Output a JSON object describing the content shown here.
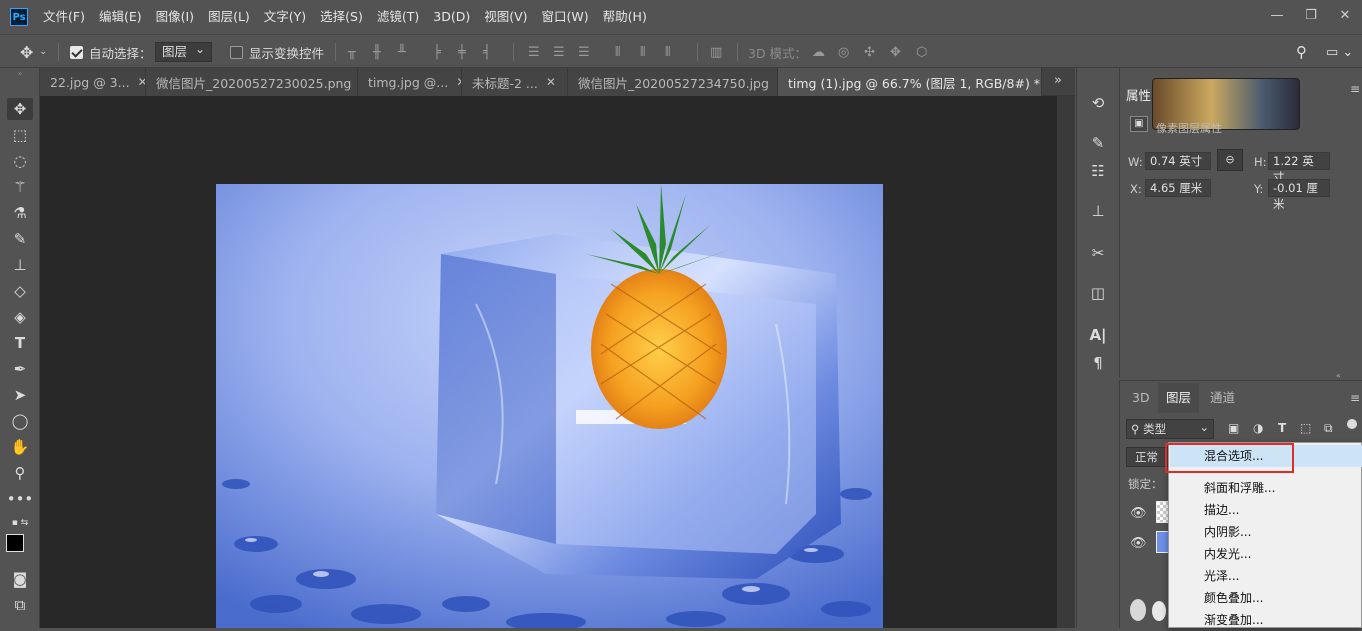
{
  "app": {
    "logo": "Ps"
  },
  "menu": [
    "文件(F)",
    "编辑(E)",
    "图像(I)",
    "图层(L)",
    "文字(Y)",
    "选择(S)",
    "滤镜(T)",
    "3D(D)",
    "视图(V)",
    "窗口(W)",
    "帮助(H)"
  ],
  "options": {
    "auto_select_label": "自动选择：",
    "auto_select_value": "图层",
    "show_transform_label": "显示变换控件",
    "mode_3d_label": "3D 模式："
  },
  "tabs": [
    {
      "label": "22.jpg @ 3...",
      "active": false
    },
    {
      "label": "微信图片_20200527230025.png",
      "active": false
    },
    {
      "label": "timg.jpg @...",
      "active": false
    },
    {
      "label": "未标题-2 ...",
      "active": false
    },
    {
      "label": "微信图片_20200527234750.jpg",
      "active": false
    },
    {
      "label": "timg (1).jpg @ 66.7% (图层 1, RGB/8#) *",
      "active": true
    }
  ],
  "properties": {
    "title": "属性",
    "subtitle": "像素图层属性",
    "w_label": "W:",
    "w_value": "0.74 英寸",
    "h_label": "H:",
    "h_value": "1.22 英寸",
    "x_label": "X:",
    "x_value": "4.65 厘米",
    "y_label": "Y:",
    "y_value": "-0.01 厘米"
  },
  "layers_panel": {
    "tabs": [
      "3D",
      "图层",
      "通道"
    ],
    "filter_label": "类型",
    "blend_mode": "正常",
    "lock_label": "锁定："
  },
  "context_menu": [
    "混合选项...",
    "斜面和浮雕...",
    "描边...",
    "内阴影...",
    "内发光...",
    "光泽...",
    "颜色叠加...",
    "渐变叠加..."
  ],
  "colors": {
    "highlight_border": "#e02b2b",
    "menu_highlight": "#cde4f7"
  }
}
